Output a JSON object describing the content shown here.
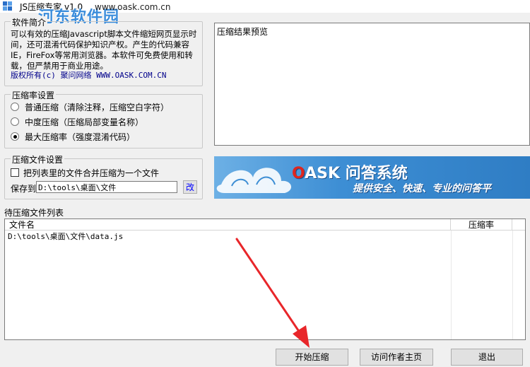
{
  "window": {
    "title": "JS压缩专家 v1.0",
    "watermark_logo": "河东软件园",
    "watermark_url": "www.oask.com.cn"
  },
  "intro": {
    "legend": "软件简介",
    "text": "可以有效的压缩Javascript脚本文件缩短网页显示时间，还可混淆代码保护知识产权。产生的代码兼容IE，FireFox等常用浏览器。本软件可免费使用和转载，但严禁用于商业用途。",
    "copyright": "版权所有(c) 聚问网络 WWW.OASK.COM.CN"
  },
  "ratio": {
    "legend": "压缩率设置",
    "options": [
      {
        "label": "普通压缩（清除注释，压缩空白字符）",
        "selected": false
      },
      {
        "label": "中度压缩（压缩局部变量名称）",
        "selected": false
      },
      {
        "label": "最大压缩率（强度混淆代码）",
        "selected": true
      }
    ]
  },
  "file_settings": {
    "legend": "压缩文件设置",
    "merge_label": "把列表里的文件合并压缩为一个文件",
    "merge_checked": false,
    "save_label": "保存到",
    "save_path": "D:\\tools\\桌面\\文件",
    "change_button": "改"
  },
  "preview": {
    "text": "压缩结果预览"
  },
  "banner": {
    "title_o": "O",
    "title_rest": "ASK 问答系统",
    "slogan": "提供安全、快速、专业的问答平"
  },
  "file_list": {
    "label": "待压缩文件列表",
    "columns": [
      "文件名",
      "压缩率"
    ],
    "rows": [
      {
        "name": "D:\\tools\\桌面\\文件\\data.js",
        "ratio": ""
      }
    ]
  },
  "buttons": {
    "start": "开始压缩",
    "visit": "访问作者主页",
    "exit": "退出"
  },
  "colors": {
    "annotation_arrow": "#e8262a",
    "banner_blue": "#3d8ed4"
  }
}
